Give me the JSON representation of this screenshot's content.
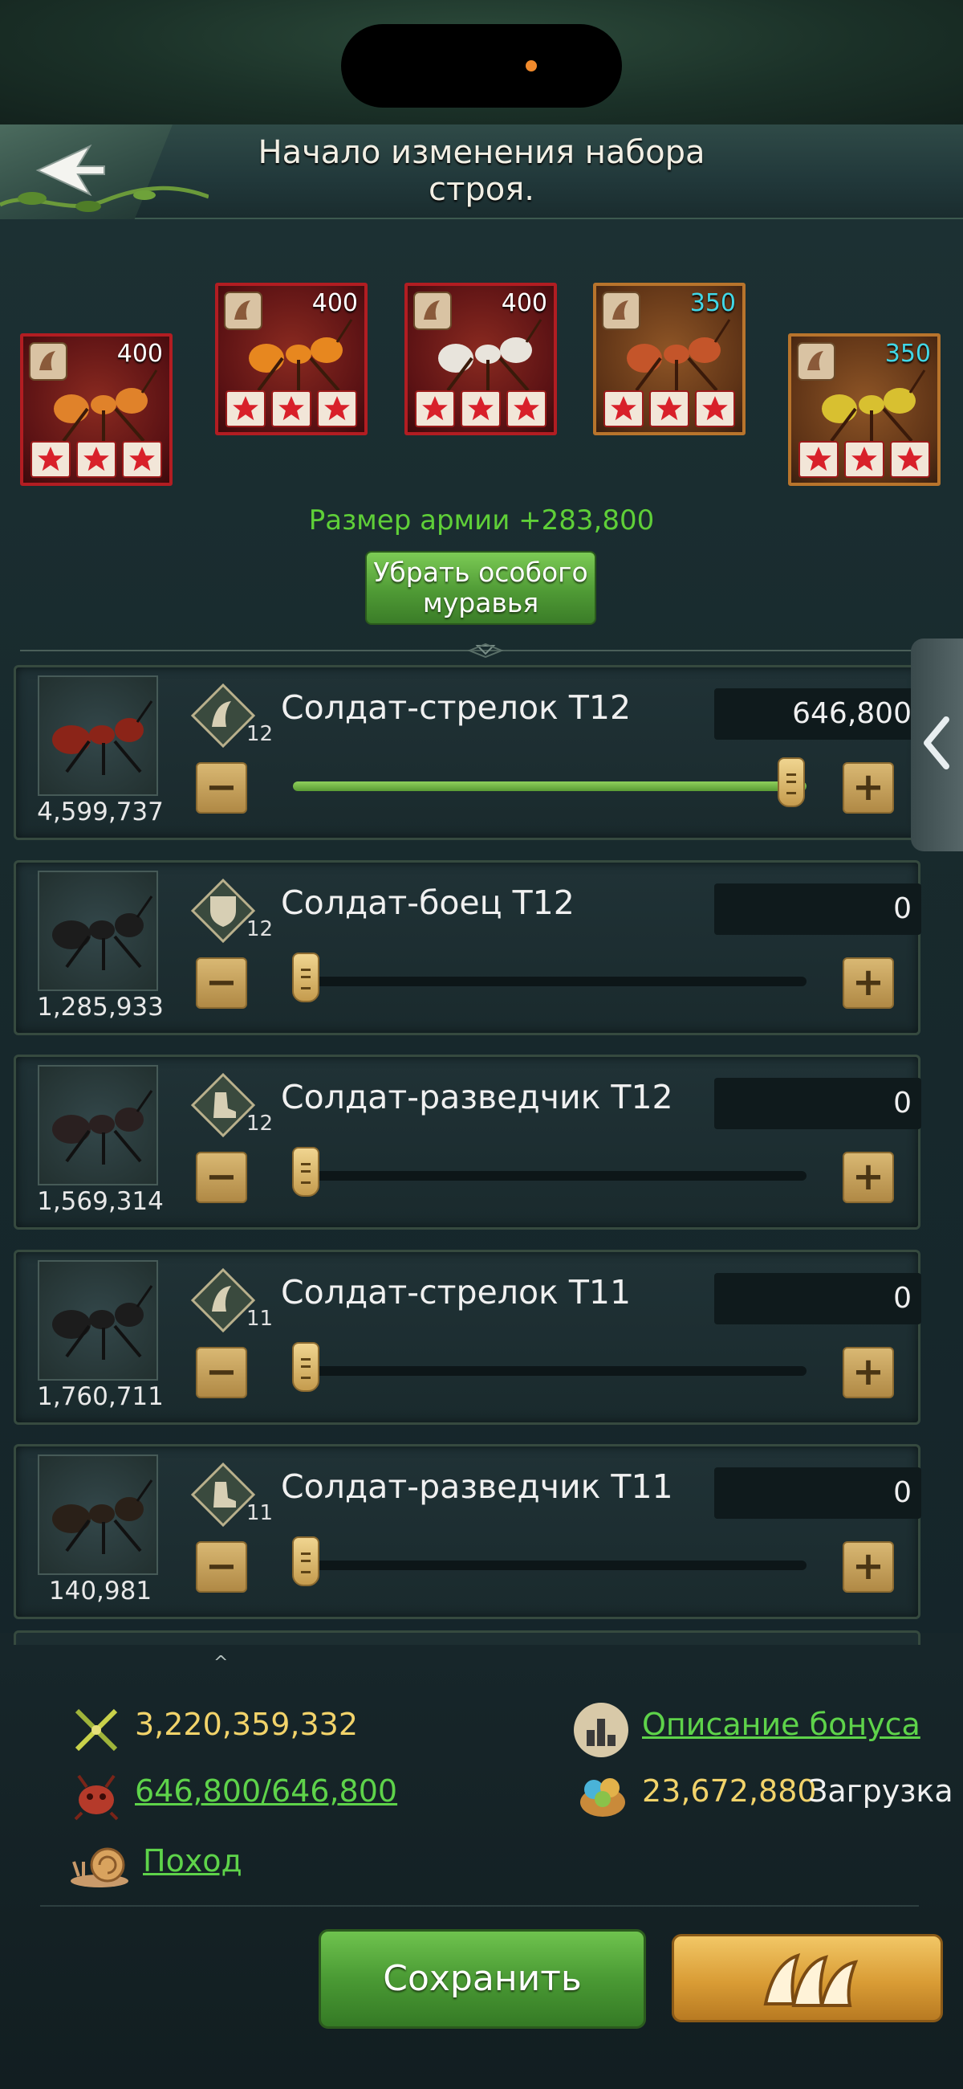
{
  "header": {
    "title": "Начало изменения набора строя.",
    "back_label": "Назад"
  },
  "special_ants": [
    {
      "level": "400",
      "stars": 3,
      "frame": "red",
      "level_color": "#ffffff"
    },
    {
      "level": "400",
      "stars": 3,
      "frame": "red",
      "level_color": "#ffffff"
    },
    {
      "level": "400",
      "stars": 3,
      "frame": "red",
      "level_color": "#ffffff"
    },
    {
      "level": "350",
      "stars": 3,
      "frame": "orange",
      "level_color": "#41d7e6"
    },
    {
      "level": "350",
      "stars": 3,
      "frame": "orange",
      "level_color": "#41d7e6"
    }
  ],
  "army_size": "Размер армии +283,800",
  "remove_special_label": "Убрать особого муравья",
  "troops": [
    {
      "name": "Солдат-стрелок T12",
      "tier": "12",
      "class_icon": "shooter-icon",
      "count": "4,599,737",
      "value": "646,800",
      "fraction": 1.0
    },
    {
      "name": "Солдат-боец T12",
      "tier": "12",
      "class_icon": "defender-icon",
      "count": "1,285,933",
      "value": "0",
      "fraction": 0.0
    },
    {
      "name": "Солдат-разведчик T12",
      "tier": "12",
      "class_icon": "scout-icon",
      "count": "1,569,314",
      "value": "0",
      "fraction": 0.0
    },
    {
      "name": "Солдат-стрелок T11",
      "tier": "11",
      "class_icon": "shooter-icon",
      "count": "1,760,711",
      "value": "0",
      "fraction": 0.0
    },
    {
      "name": "Солдат-разведчик T11",
      "tier": "11",
      "class_icon": "scout-icon",
      "count": "140,981",
      "value": "0",
      "fraction": 0.0
    }
  ],
  "bottom": {
    "power": "3,220,359,332",
    "troop_capacity": "646,800/646,800",
    "march_label": "Поход",
    "bonus_label": "Описание бонуса",
    "load_value": "23,672,880",
    "load_label": "Загрузка",
    "save_label": "Сохранить"
  },
  "colors": {
    "accent_green": "#5fcf38",
    "gold_text": "#f2d36a",
    "card_red": "#b21d22",
    "card_orange": "#b8742c"
  }
}
